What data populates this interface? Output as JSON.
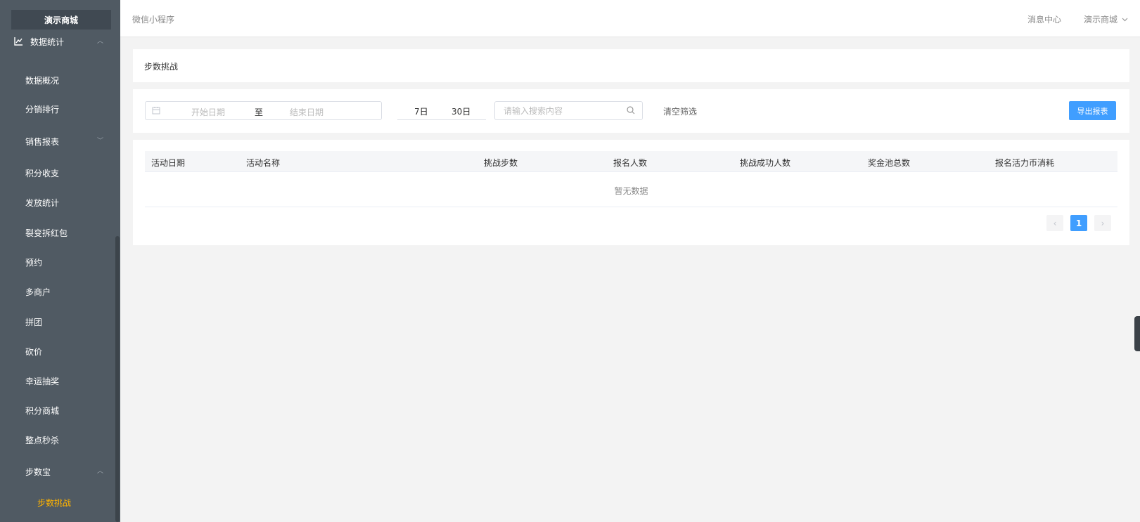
{
  "sidebar": {
    "logo": "演示商城",
    "items": [
      {
        "label": "数据统计"
      },
      {
        "label": "数据概况"
      },
      {
        "label": "分销排行"
      },
      {
        "label": "销售报表"
      },
      {
        "label": "积分收支"
      },
      {
        "label": "发放统计"
      },
      {
        "label": "裂变拆红包"
      },
      {
        "label": "预约"
      },
      {
        "label": "多商户"
      },
      {
        "label": "拼团"
      },
      {
        "label": "砍价"
      },
      {
        "label": "幸运抽奖"
      },
      {
        "label": "积分商城"
      },
      {
        "label": "整点秒杀"
      },
      {
        "label": "步数宝"
      },
      {
        "label": "步数挑战"
      }
    ]
  },
  "header": {
    "title": "微信小程序",
    "message_center": "消息中心",
    "shop_name": "演示商城"
  },
  "page": {
    "title": "步数挑战"
  },
  "filter": {
    "start_placeholder": "开始日期",
    "separator": "至",
    "end_placeholder": "结束日期",
    "quick_7": "7日",
    "quick_30": "30日",
    "search_placeholder": "请输入搜索内容",
    "clear": "清空筛选",
    "export": "导出报表"
  },
  "table": {
    "columns": [
      "活动日期",
      "活动名称",
      "挑战步数",
      "报名人数",
      "挑战成功人数",
      "奖金池总数",
      "报名活力币消耗"
    ],
    "empty_text": "暂无数据"
  },
  "pagination": {
    "current": "1",
    "prev": "‹",
    "next": "›"
  },
  "colors": {
    "sidebar_bg": "#505a63",
    "accent": "#409eff",
    "active_menu": "#ffb400"
  }
}
